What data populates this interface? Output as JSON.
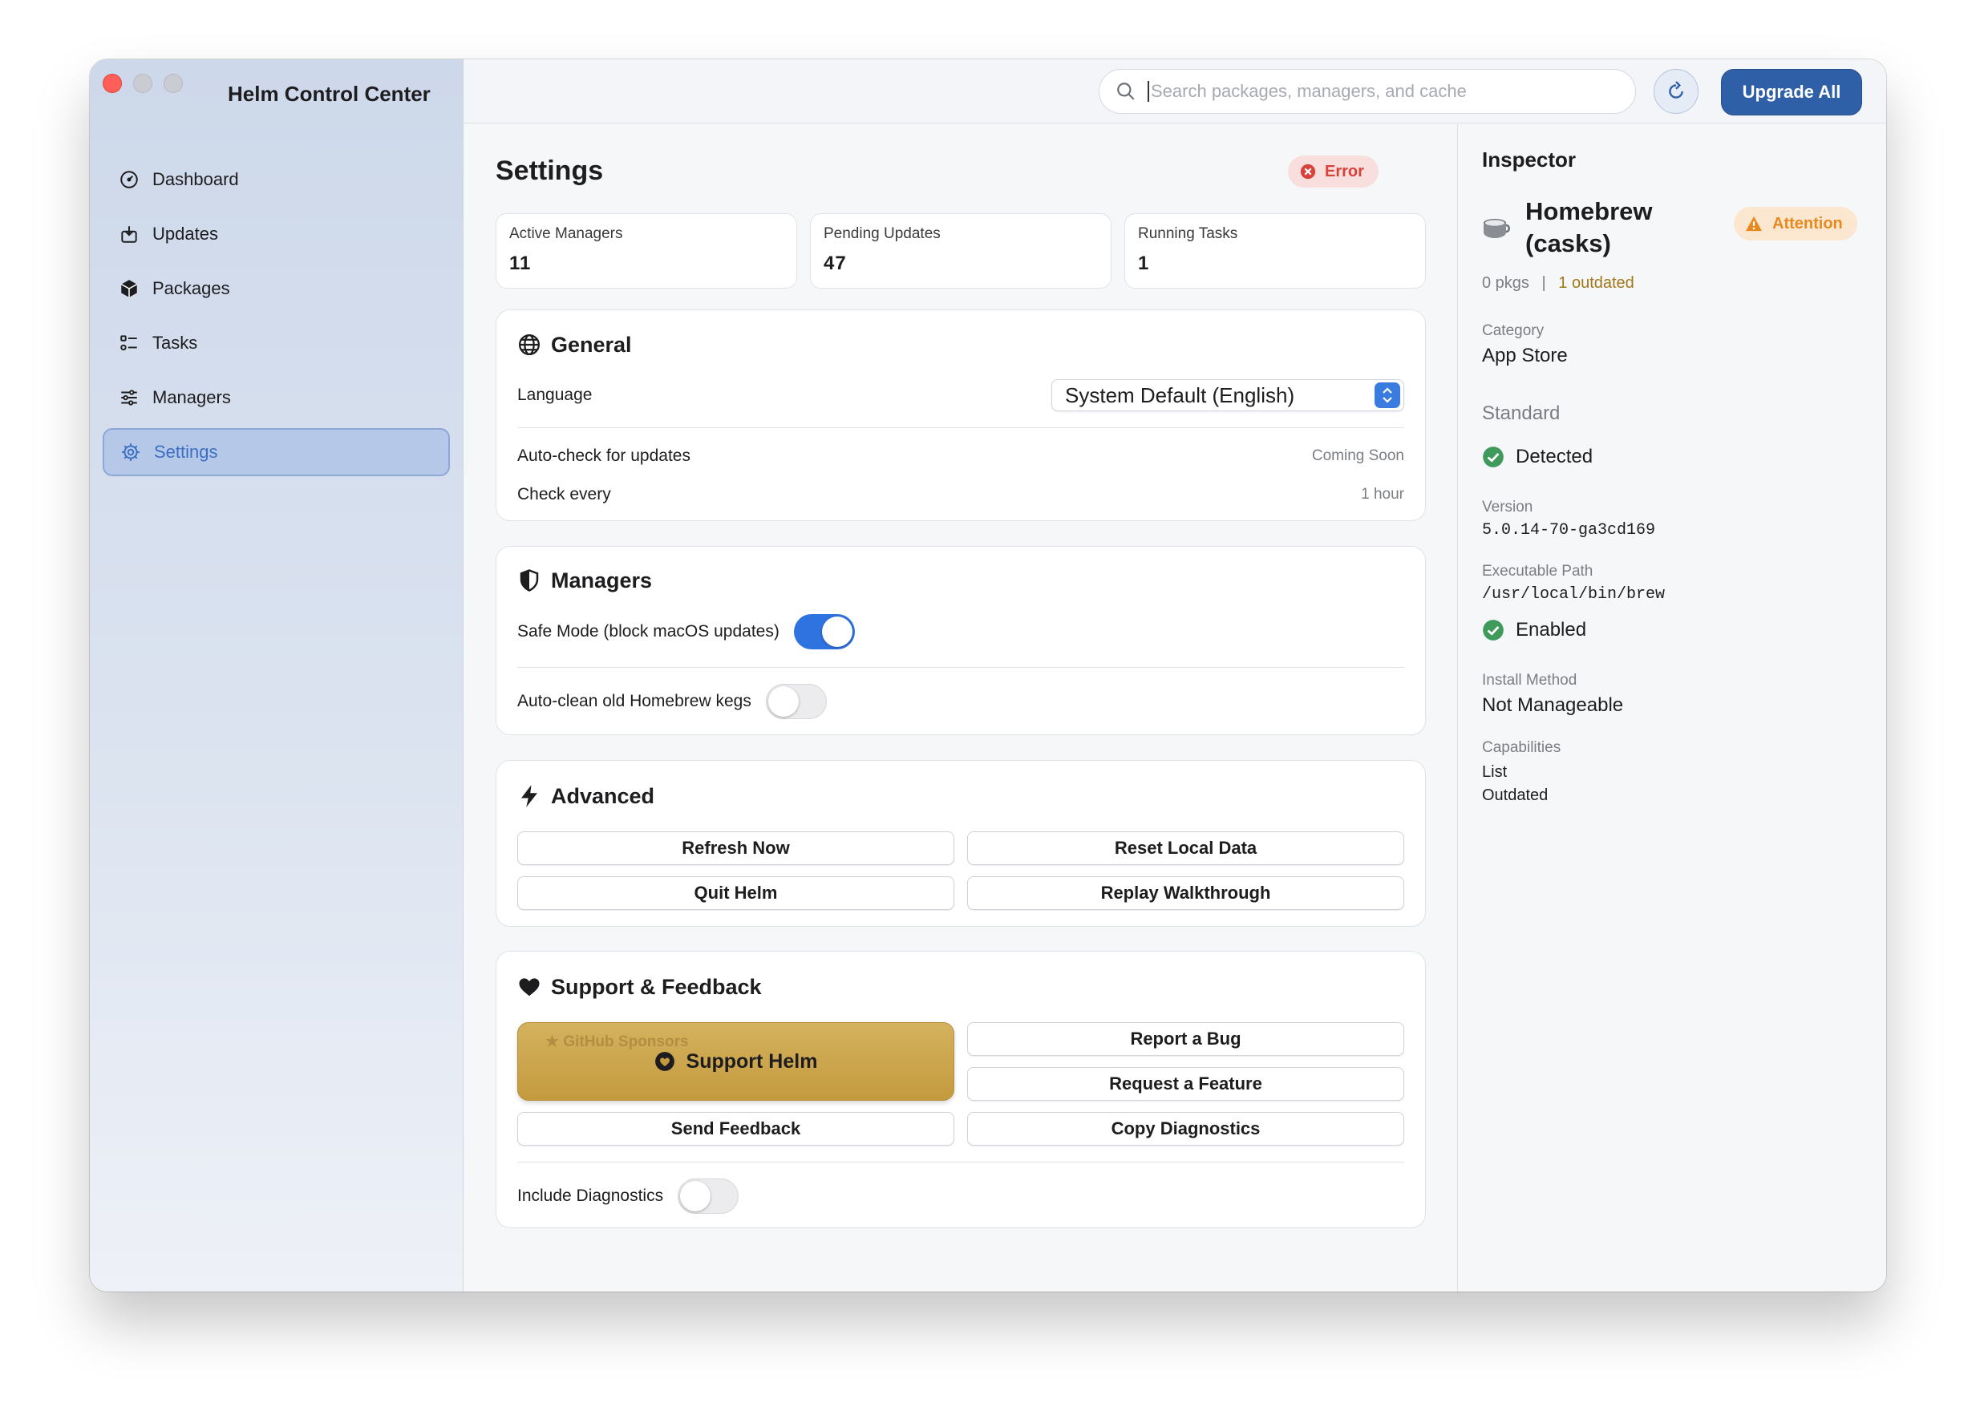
{
  "window": {
    "app_title": "Helm Control Center"
  },
  "sidebar": {
    "items": [
      {
        "label": "Dashboard",
        "icon": "gauge-icon",
        "active": false
      },
      {
        "label": "Updates",
        "icon": "updates-icon",
        "active": false
      },
      {
        "label": "Packages",
        "icon": "package-icon",
        "active": false
      },
      {
        "label": "Tasks",
        "icon": "tasks-icon",
        "active": false
      },
      {
        "label": "Managers",
        "icon": "sliders-icon",
        "active": false
      },
      {
        "label": "Settings",
        "icon": "gear-icon",
        "active": true
      }
    ]
  },
  "toolbar": {
    "search_placeholder": "Search packages, managers, and cache",
    "upgrade_label": "Upgrade All"
  },
  "main": {
    "title": "Settings",
    "error_badge": "Error",
    "stats": [
      {
        "label": "Active Managers",
        "value": "11"
      },
      {
        "label": "Pending Updates",
        "value": "47"
      },
      {
        "label": "Running Tasks",
        "value": "1"
      }
    ],
    "general": {
      "title": "General",
      "language_label": "Language",
      "language_value": "System Default (English)",
      "autocheck_label": "Auto-check for updates",
      "autocheck_value": "Coming Soon",
      "check_every_label": "Check every",
      "check_every_value": "1 hour"
    },
    "managers": {
      "title": "Managers",
      "safe_mode_label": "Safe Mode (block macOS updates)",
      "safe_mode_on": true,
      "autoclean_label": "Auto-clean old Homebrew kegs",
      "autoclean_on": false
    },
    "advanced": {
      "title": "Advanced",
      "refresh_now": "Refresh Now",
      "reset_local_data": "Reset Local Data",
      "quit_helm": "Quit Helm",
      "replay_walkthrough": "Replay Walkthrough"
    },
    "support": {
      "title": "Support & Feedback",
      "support_helm": "Support Helm",
      "github_sponsors": "GitHub Sponsors",
      "report_bug": "Report a Bug",
      "request_feature": "Request a Feature",
      "send_feedback": "Send Feedback",
      "copy_diagnostics": "Copy Diagnostics",
      "include_diagnostics_label": "Include Diagnostics",
      "include_diagnostics_on": false
    }
  },
  "inspector": {
    "title": "Inspector",
    "manager_name": "Homebrew (casks)",
    "attention_badge": "Attention",
    "pkgs": "0 pkgs",
    "separator": "|",
    "outdated": "1 outdated",
    "category_label": "Category",
    "category_value": "App Store",
    "tier": "Standard",
    "detected": "Detected",
    "version_label": "Version",
    "version_value": "5.0.14-70-ga3cd169",
    "path_label": "Executable Path",
    "path_value": "/usr/local/bin/brew",
    "enabled": "Enabled",
    "install_method_label": "Install Method",
    "install_method_value": "Not Manageable",
    "capabilities_label": "Capabilities",
    "capabilities": [
      "List",
      "Outdated"
    ]
  },
  "colors": {
    "accent": "#2f5fa6",
    "toggle_on": "#2f73e0",
    "error": "#d8423a",
    "attention": "#e58a1f",
    "success": "#3f9a5c",
    "gold": "#c49a3e"
  }
}
